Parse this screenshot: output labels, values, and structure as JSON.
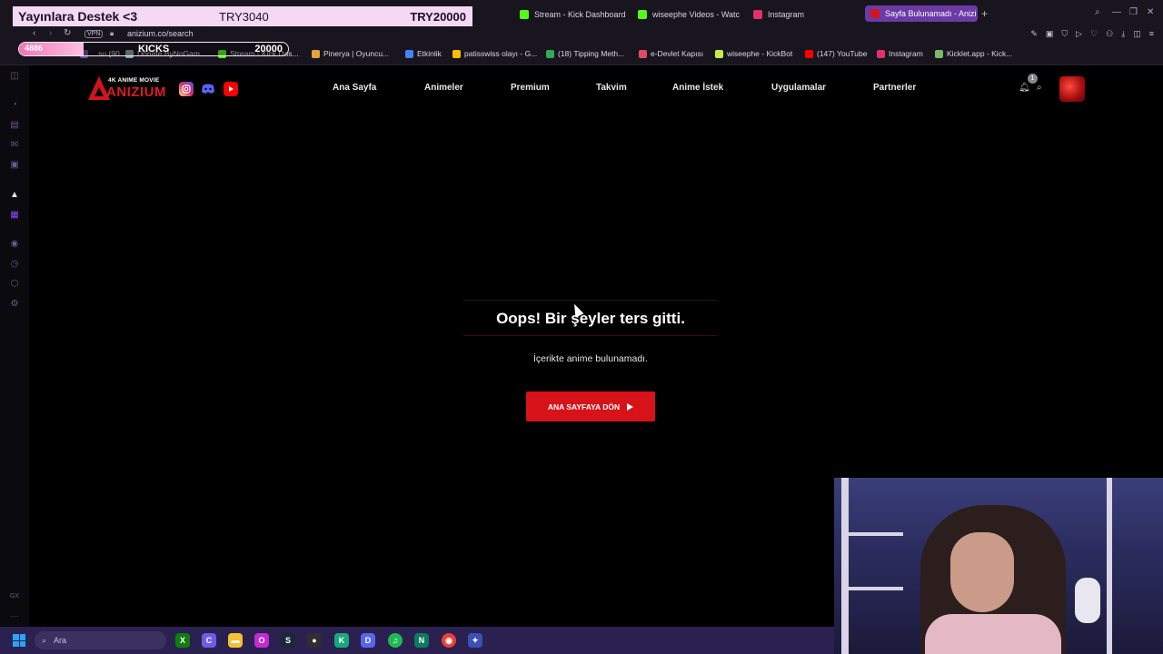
{
  "browser": {
    "tabs": [
      {
        "title": "Stream - Kick Dashboard",
        "favicon_color": "#53fc18"
      },
      {
        "title": "wiseephe Videos - Watch",
        "favicon_color": "#53fc18"
      },
      {
        "title": "Instagram",
        "favicon_color": "#e1306c"
      },
      {
        "title": "Sayfa Bulunamadı - Anizi",
        "favicon_color": "#d2141b",
        "active": true
      }
    ],
    "new_tab": "+",
    "vpn": "VPN",
    "url": "anizium.co/search",
    "bookmarks": [
      {
        "label": "...su (90...",
        "color": "#6b4fa0"
      },
      {
        "label": "Donate ByNoGam...",
        "color": "#8aa"
      },
      {
        "label": "Stream - Kick Das...",
        "color": "#53fc18"
      },
      {
        "label": "Pinerya | Oyuncu...",
        "color": "#e6a23c"
      },
      {
        "label": "Etkinlik",
        "color": "#4285f4"
      },
      {
        "label": "patisswiss olayı - G...",
        "color": "#fbbc05"
      },
      {
        "label": "(18) Tipping Meth...",
        "color": "#34a853"
      },
      {
        "label": "e-Devlet Kapısı",
        "color": "#e04a6a"
      },
      {
        "label": "wiseephe - KickBot",
        "color": "#c9e94a"
      },
      {
        "label": "(147) YouTube",
        "color": "#ff0000"
      },
      {
        "label": "Instagram",
        "color": "#e1306c"
      },
      {
        "label": "Kicklet.app - Kick...",
        "color": "#7ab86a"
      }
    ]
  },
  "overlay": {
    "donation_label": "Yayınlara Destek <3",
    "donation_current": "TRY3040",
    "donation_goal": "TRY20000",
    "kicks_count": "4886",
    "kicks_name": "KICKS",
    "kicks_goal": "20000",
    "kicks_progress": 0.24
  },
  "site": {
    "logo_sub": "4K ANIME MOVIE",
    "logo_name": "ANIZIUM",
    "social": [
      {
        "name": "instagram-icon",
        "color": "#d62976"
      },
      {
        "name": "discord-icon",
        "color": "#5865f2"
      },
      {
        "name": "youtube-icon",
        "color": "#ff0000"
      }
    ],
    "nav": [
      "Ana Sayfa",
      "Animeler",
      "Premium",
      "Takvim",
      "Anime İstek",
      "Uygulamalar",
      "Partnerler"
    ],
    "notification_count": "1",
    "error_title": "Oops! Bir şeyler ters gitti.",
    "error_message": "İçerikte anime bulunamadı.",
    "home_button": "ANA SAYFAYA DÖN"
  },
  "taskbar": {
    "search_placeholder": "Ara",
    "apps": [
      {
        "name": "xbox-icon",
        "color": "#107c10",
        "glyph": "X"
      },
      {
        "name": "copilot-icon",
        "color": "#6d5ce8",
        "glyph": "C"
      },
      {
        "name": "file-explorer-icon",
        "color": "#f3c033",
        "glyph": "▬"
      },
      {
        "name": "opera-gx-icon",
        "color": "#c22bd1",
        "glyph": "O"
      },
      {
        "name": "steam-icon",
        "color": "#1b2838",
        "glyph": "S"
      },
      {
        "name": "obs-icon",
        "color": "#302e31",
        "glyph": "●"
      },
      {
        "name": "kick-studio-icon",
        "color": "#1aa87a",
        "glyph": "K"
      },
      {
        "name": "discord-app-icon",
        "color": "#5865f2",
        "glyph": "D"
      },
      {
        "name": "spotify-icon",
        "color": "#1db954",
        "glyph": "♫"
      },
      {
        "name": "notes-icon",
        "color": "#0e7a5f",
        "glyph": "N"
      },
      {
        "name": "chrome-icon",
        "color": "#e94235",
        "glyph": "◉"
      },
      {
        "name": "settings-app-icon",
        "color": "#3a4fb8",
        "glyph": "✦"
      }
    ]
  },
  "colors": {
    "accent": "#d71218",
    "chrome_bg": "#19151f",
    "taskbar_bg": "#2a2150"
  }
}
